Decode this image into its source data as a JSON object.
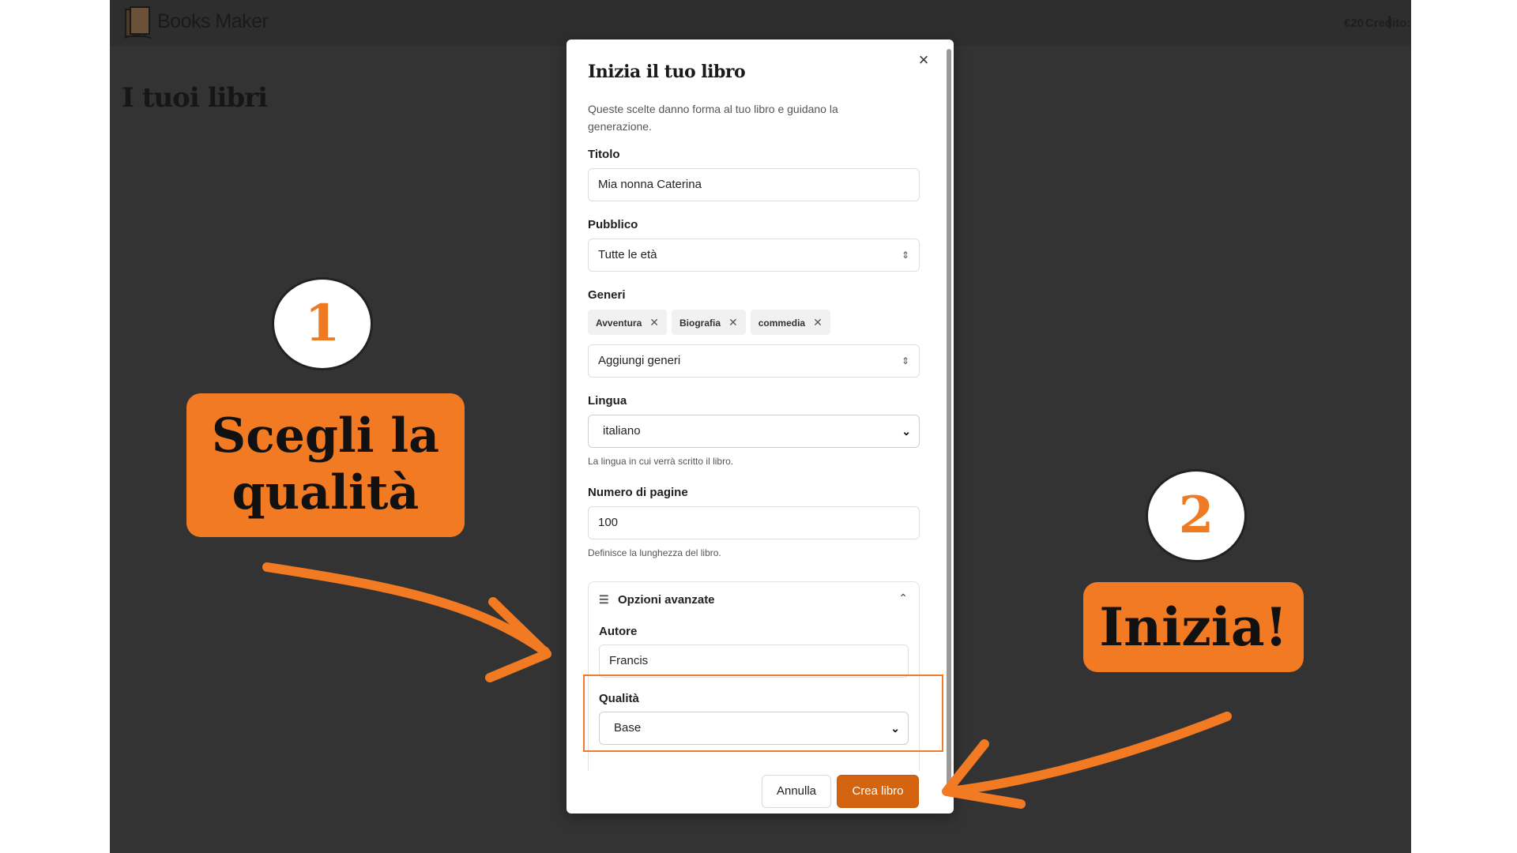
{
  "app": {
    "name": "Books Maker",
    "credit_label": "Credito:",
    "credit_value": "€20",
    "page_title": "I tuoi libri"
  },
  "modal": {
    "title": "Inizia il tuo libro",
    "description": "Queste scelte danno forma al tuo libro e guidano la generazione.",
    "close_label": "×",
    "fields": {
      "title": {
        "label": "Titolo",
        "value": "Mia nonna Caterina"
      },
      "audience": {
        "label": "Pubblico",
        "value": "Tutte le età"
      },
      "genres": {
        "label": "Generi",
        "chips": [
          "Avventura",
          "Biografia",
          "commedia"
        ],
        "placeholder": "Aggiungi generi"
      },
      "language": {
        "label": "Lingua",
        "value": "italiano",
        "hint": "La lingua in cui verrà scritto il libro."
      },
      "pages": {
        "label": "Numero di pagine",
        "value": "100",
        "hint": "Definisce la lunghezza del libro."
      }
    },
    "advanced": {
      "title": "Opzioni avanzate",
      "author": {
        "label": "Autore",
        "value": "Francis"
      },
      "quality": {
        "label": "Qualità",
        "value": "Base"
      }
    },
    "buttons": {
      "cancel": "Annulla",
      "create": "Crea libro"
    }
  },
  "annotations": {
    "step1_number": "1",
    "step1_text_line1": "Scegli la",
    "step1_text_line2": "qualità",
    "step2_number": "2",
    "step2_text": "Inizia!"
  },
  "colors": {
    "accent": "#f27a22",
    "button_primary": "#d4640f",
    "background_dark": "#333333"
  }
}
